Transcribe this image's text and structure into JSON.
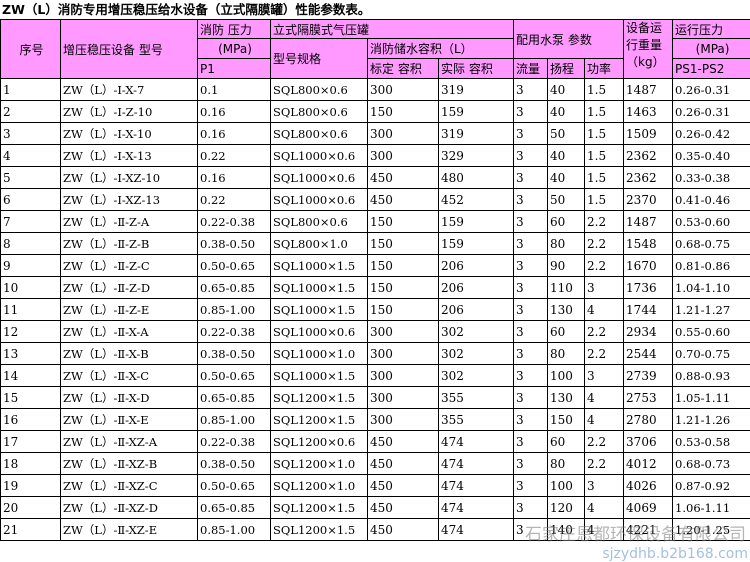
{
  "title": "ZW（L）消防专用增压稳压给水设备（立式隔膜罐）性能参数表。",
  "header": {
    "seq": "序号",
    "model": "增压稳压设备 型号",
    "pressure": "消防 压力",
    "pressure_unit": "(MPa)",
    "pressure_p1": "P1",
    "tank_group": "立式隔膜式气压罐",
    "tank_model": "型号规格",
    "volume_group": "消防储水容积（L）",
    "volume_nominal": "标定 容积",
    "volume_actual": "实际 容积",
    "pump_group": "配用水泵 参数",
    "pump_flow": "流量",
    "pump_head": "扬程",
    "pump_power": "功率",
    "weight": "设备运行重量",
    "weight_unit": "（kg）",
    "run_pressure": "运行压力",
    "run_pressure_unit": "(MPa)",
    "run_pressure_ps": "PS1-PS2"
  },
  "rows": [
    {
      "seq": "1",
      "model": "ZW（L）-Ⅰ-X-7",
      "p1": "0.1",
      "tank": "SQL800×0.6",
      "nominal": "300",
      "actual": "319",
      "flow": "3",
      "head": "40",
      "power": "1.5",
      "weight": "1487",
      "ps": "0.26-0.31"
    },
    {
      "seq": "2",
      "model": "ZW（L）-Ⅰ-Z-10",
      "p1": "0.16",
      "tank": "SQL800×0.6",
      "nominal": "150",
      "actual": "159",
      "flow": "3",
      "head": "40",
      "power": "1.5",
      "weight": "1463",
      "ps": "0.26-0.31"
    },
    {
      "seq": "3",
      "model": "ZW（L）-Ⅰ-X-10",
      "p1": "0.16",
      "tank": "SQL800×0.6",
      "nominal": "300",
      "actual": "319",
      "flow": "3",
      "head": "50",
      "power": "1.5",
      "weight": "1509",
      "ps": "0.26-0.42"
    },
    {
      "seq": "4",
      "model": "ZW（L）-Ⅰ-X-13",
      "p1": "0.22",
      "tank": "SQL1000×0.6",
      "nominal": "300",
      "actual": "329",
      "flow": "3",
      "head": "40",
      "power": "1.5",
      "weight": "2362",
      "ps": "0.35-0.40"
    },
    {
      "seq": "5",
      "model": "ZW（L）-Ⅰ-XZ-10",
      "p1": "0.16",
      "tank": "SQL1000×0.6",
      "nominal": "450",
      "actual": "480",
      "flow": "3",
      "head": "40",
      "power": "1.5",
      "weight": "2362",
      "ps": "0.33-0.38"
    },
    {
      "seq": "6",
      "model": "ZW（L）-Ⅰ-XZ-13",
      "p1": "0.22",
      "tank": "SQL1000×0.6",
      "nominal": "450",
      "actual": "452",
      "flow": "3",
      "head": "50",
      "power": "1.5",
      "weight": "2370",
      "ps": "0.41-0.46"
    },
    {
      "seq": "7",
      "model": "ZW（L）-Ⅱ-Z-A",
      "p1": "0.22-0.38",
      "tank": "SQL800×0.6",
      "nominal": "150",
      "actual": "159",
      "flow": "3",
      "head": "60",
      "power": "2.2",
      "weight": "1487",
      "ps": "0.53-0.60"
    },
    {
      "seq": "8",
      "model": "ZW（L）-Ⅱ-Z-B",
      "p1": "0.38-0.50",
      "tank": "SQL800×1.0",
      "nominal": "150",
      "actual": "159",
      "flow": "3",
      "head": "80",
      "power": "2.2",
      "weight": "1548",
      "ps": "0.68-0.75"
    },
    {
      "seq": "9",
      "model": "ZW（L）-Ⅱ-Z-C",
      "p1": "0.50-0.65",
      "tank": "SQL1000×1.5",
      "nominal": "150",
      "actual": "206",
      "flow": "3",
      "head": "90",
      "power": "2.2",
      "weight": "1670",
      "ps": "0.81-0.86"
    },
    {
      "seq": "10",
      "model": "ZW（L）-Ⅱ-Z-D",
      "p1": "0.65-0.85",
      "tank": "SQL1000×1.5",
      "nominal": "150",
      "actual": "206",
      "flow": "3",
      "head": "110",
      "power": "3",
      "weight": "1736",
      "ps": "1.04-1.10"
    },
    {
      "seq": "11",
      "model": "ZW（L）-Ⅱ-Z-E",
      "p1": "0.85-1.00",
      "tank": "SQL1000×1.5",
      "nominal": "150",
      "actual": "206",
      "flow": "3",
      "head": "130",
      "power": "4",
      "weight": "1744",
      "ps": "1.21-1.27"
    },
    {
      "seq": "12",
      "model": "ZW（L）-Ⅱ-X-A",
      "p1": "0.22-0.38",
      "tank": "SQL1000×0.6",
      "nominal": "300",
      "actual": "302",
      "flow": "3",
      "head": "60",
      "power": "2.2",
      "weight": "2934",
      "ps": "0.55-0.60"
    },
    {
      "seq": "13",
      "model": "ZW（L）-Ⅱ-X-B",
      "p1": "0.38-0.50",
      "tank": "SQL1000×1.0",
      "nominal": "300",
      "actual": "302",
      "flow": "3",
      "head": "80",
      "power": "2.2",
      "weight": "2544",
      "ps": "0.70-0.75"
    },
    {
      "seq": "14",
      "model": "ZW（L）-Ⅱ-X-C",
      "p1": "0.50-0.65",
      "tank": "SQL1000×1.5",
      "nominal": "300",
      "actual": "302",
      "flow": "3",
      "head": "100",
      "power": "3",
      "weight": "2739",
      "ps": "0.88-0.93"
    },
    {
      "seq": "15",
      "model": "ZW（L）-Ⅱ-X-D",
      "p1": "0.65-0.85",
      "tank": "SQL1200×1.5",
      "nominal": "300",
      "actual": "355",
      "flow": "3",
      "head": "130",
      "power": "4",
      "weight": "2753",
      "ps": "1.05-1.11"
    },
    {
      "seq": "16",
      "model": "ZW（L）-Ⅱ-X-E",
      "p1": "0.85-1.00",
      "tank": "SQL1200×1.5",
      "nominal": "300",
      "actual": "355",
      "flow": "3",
      "head": "150",
      "power": "4",
      "weight": "2780",
      "ps": "1.21-1.26"
    },
    {
      "seq": "17",
      "model": "ZW（L）-Ⅱ-XZ-A",
      "p1": "0.22-0.38",
      "tank": "SQL1200×0.6",
      "nominal": "450",
      "actual": "474",
      "flow": "3",
      "head": "60",
      "power": "2.2",
      "weight": "3706",
      "ps": "0.53-0.58"
    },
    {
      "seq": "18",
      "model": "ZW（L）-Ⅱ-XZ-B",
      "p1": "0.38-0.50",
      "tank": "SQL1200×1.0",
      "nominal": "450",
      "actual": "474",
      "flow": "3",
      "head": "80",
      "power": "2.2",
      "weight": "4012",
      "ps": "0.68-0.73"
    },
    {
      "seq": "19",
      "model": "ZW（L）-Ⅱ-XZ-C",
      "p1": "0.50-0.65",
      "tank": "SQL1200×1.0",
      "nominal": "450",
      "actual": "474",
      "flow": "3",
      "head": "100",
      "power": "3",
      "weight": "4026",
      "ps": "0.87-0.92"
    },
    {
      "seq": "20",
      "model": "ZW（L）-Ⅱ-XZ-D",
      "p1": "0.65-0.85",
      "tank": "SQL1200×1.5",
      "nominal": "450",
      "actual": "474",
      "flow": "3",
      "head": "120",
      "power": "4",
      "weight": "4069",
      "ps": "1.06-1.11"
    },
    {
      "seq": "21",
      "model": "ZW（L）-Ⅱ-XZ-E",
      "p1": "0.85-1.00",
      "tank": "SQL1200×1.5",
      "nominal": "450",
      "actual": "474",
      "flow": "3",
      "head": "140",
      "power": "4",
      "weight": "4221",
      "ps": "1.20-1.25"
    }
  ],
  "watermark": "石家庄恩都环保设备有限公司",
  "watermark_url": "sjzydhb.b2b168.com"
}
